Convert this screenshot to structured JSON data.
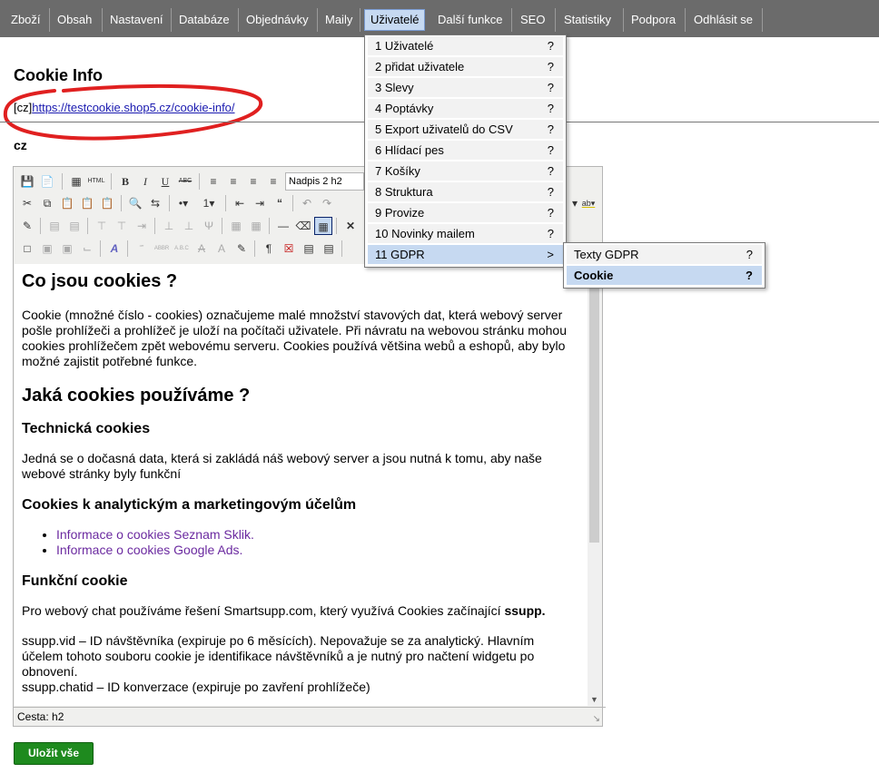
{
  "nav": {
    "items": [
      "Zboží",
      "Obsah",
      "Nastavení",
      "Databáze",
      "Objednávky",
      "Maily",
      "Uživatelé",
      "Další funkce",
      "SEO",
      "Statistiky",
      "Podpora",
      "Odhlásit se"
    ]
  },
  "page": {
    "title": "Cookie Info",
    "lang_prefix": "[cz]",
    "url": "https://testcookie.shop5.cz/cookie-info/",
    "lang_label": "cz"
  },
  "editor": {
    "format_select": "Nadpis 2 h2",
    "status": "Cesta: h2",
    "content": {
      "h1": "Co jsou cookies ?",
      "p1": "Cookie (množné číslo - cookies) označujeme malé množství stavových dat, která webový server pošle prohlížeči a prohlížeč je uloží na počítači uživatele. Při návratu na webovou stránku mohou cookies prohlížečem zpět webovému serveru. Cookies používá většina webů a eshopů, aby bylo možné zajistit potřebné funkce.",
      "h2": "Jaká cookies používáme ?",
      "h3a": "Technická cookies",
      "p2": "Jedná se o dočasná data, která si zakládá náš webový server a jsou nutná k tomu, aby naše webové stránky byly funkční",
      "h3b": "Cookies k analytickým a marketingovým účelům",
      "links": [
        "Informace o cookies Seznam Sklik.",
        "Informace o cookies Google Ads."
      ],
      "h3c": "Funkční cookie",
      "p3_pre": "Pro webový chat používáme řešení Smartsupp.com, který využívá Cookies začínající ",
      "p3_bold": "ssupp.",
      "p4a": "ssupp.vid – ID návštěvníka (expiruje po 6 měsících). Nepovažuje se za analytický. Hlavním účelem tohoto souboru cookie je identifikace návštěvníků a je nutný pro načtení widgetu po obnovení.",
      "p4b": "ssupp.chatid – ID konverzace (expiruje po zavření prohlížeče)"
    }
  },
  "save_label": "Uložit vše",
  "menu": {
    "items": [
      {
        "label": "1 Uživatelé",
        "mark": "?"
      },
      {
        "label": "2 přidat uživatele",
        "mark": "?"
      },
      {
        "label": "3 Slevy",
        "mark": "?"
      },
      {
        "label": "4 Poptávky",
        "mark": "?"
      },
      {
        "label": "5 Export uživatelů do CSV",
        "mark": "?"
      },
      {
        "label": "6 Hlídací pes",
        "mark": "?"
      },
      {
        "label": "7 Košíky",
        "mark": "?"
      },
      {
        "label": "8 Struktura",
        "mark": "?"
      },
      {
        "label": "9 Provize",
        "mark": "?"
      },
      {
        "label": "10 Novinky mailem",
        "mark": "?"
      },
      {
        "label": "11 GDPR",
        "mark": ">"
      }
    ],
    "sub": [
      {
        "label": "Texty GDPR",
        "mark": "?"
      },
      {
        "label": "Cookie",
        "mark": "?"
      }
    ]
  }
}
